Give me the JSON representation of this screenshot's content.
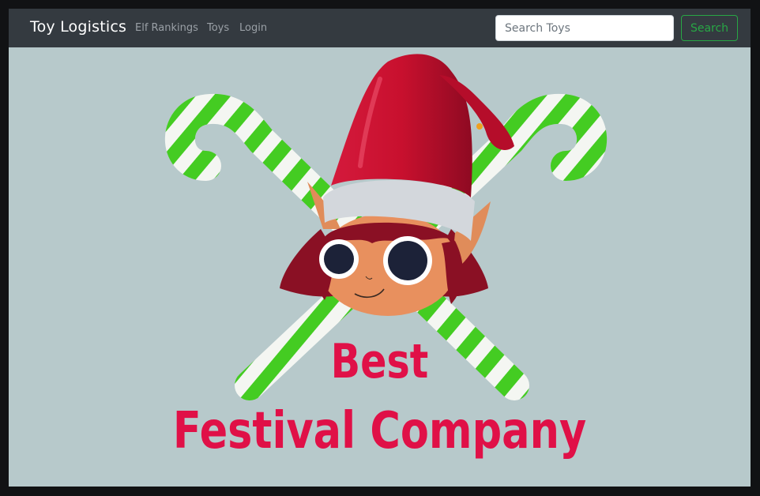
{
  "navbar": {
    "brand": "Toy Logistics",
    "links": [
      "Elf Rankings",
      "Toys",
      "Login"
    ]
  },
  "search": {
    "placeholder": "Search Toys",
    "value": "",
    "button_label": "Search"
  },
  "hero": {
    "logo_text_line1": "Best",
    "logo_text_line2": "Festival Company",
    "colors": {
      "background": "#b7c9cb",
      "hat_red": "#c8102e",
      "cane_green": "#44cc22",
      "text_red": "#e01047"
    },
    "icons": [
      "candy-cane-icon",
      "elf-head-icon"
    ]
  }
}
